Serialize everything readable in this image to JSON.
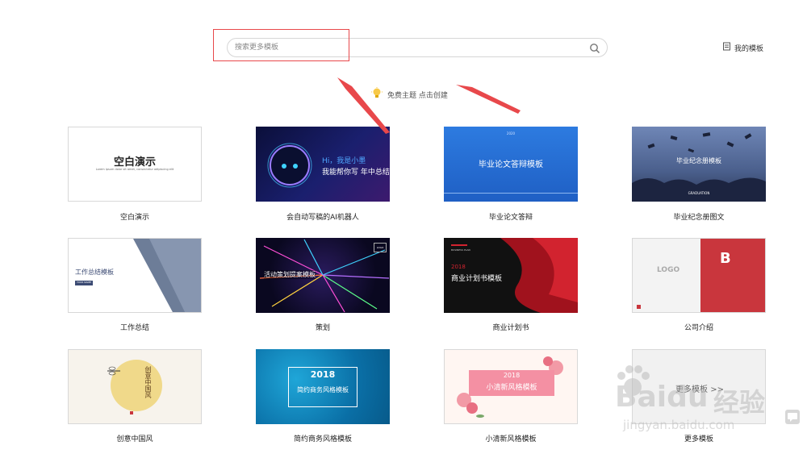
{
  "search": {
    "placeholder": "搜索更多模板"
  },
  "header": {
    "my_templates": "我的模板"
  },
  "hint": {
    "free_theme": "免费主题 点击创建"
  },
  "templates": [
    {
      "label": "空白演示",
      "title": "空白演示",
      "sub": "Lorem ipsum dolor sit amet, consectetur adipiscing elit"
    },
    {
      "label": "会自动写稿的AI机器人",
      "line1": "Hi，我是小墨",
      "line2": "我能帮你写 年中总结"
    },
    {
      "label": "毕业论文答辩",
      "title": "毕业论文答辩模板",
      "top": "2020"
    },
    {
      "label": "毕业纪念册图文",
      "title": "毕业纪念册模板",
      "sub": "GRADUATION"
    },
    {
      "label": "工作总结",
      "title": "工作总结模板",
      "btn": "YOUR NAME"
    },
    {
      "label": "策划",
      "title": "活动策划提案模板",
      "logo": "LOGO"
    },
    {
      "label": "商业计划书",
      "year": "2018",
      "title": "商业计划书模板",
      "top": "BUSINESS PLAN"
    },
    {
      "label": "公司介绍",
      "logo": "LOGO",
      "letter": "B"
    },
    {
      "label": "创意中国风",
      "title": "创意中国风"
    },
    {
      "label": "简约商务风格模板",
      "year": "2018",
      "title": "简约商务风格模板"
    },
    {
      "label": "小清新风格模板",
      "year": "2018",
      "title": "小清新风格模板"
    },
    {
      "label": "更多模板",
      "title": "更多模板 >>"
    }
  ],
  "watermark": {
    "brand": "Baidu",
    "brand_cn": "经验",
    "url": "jingyan.baidu.com"
  },
  "colors": {
    "annotation_red": "#e8484b",
    "accent_blue": "#2f6fd8"
  }
}
